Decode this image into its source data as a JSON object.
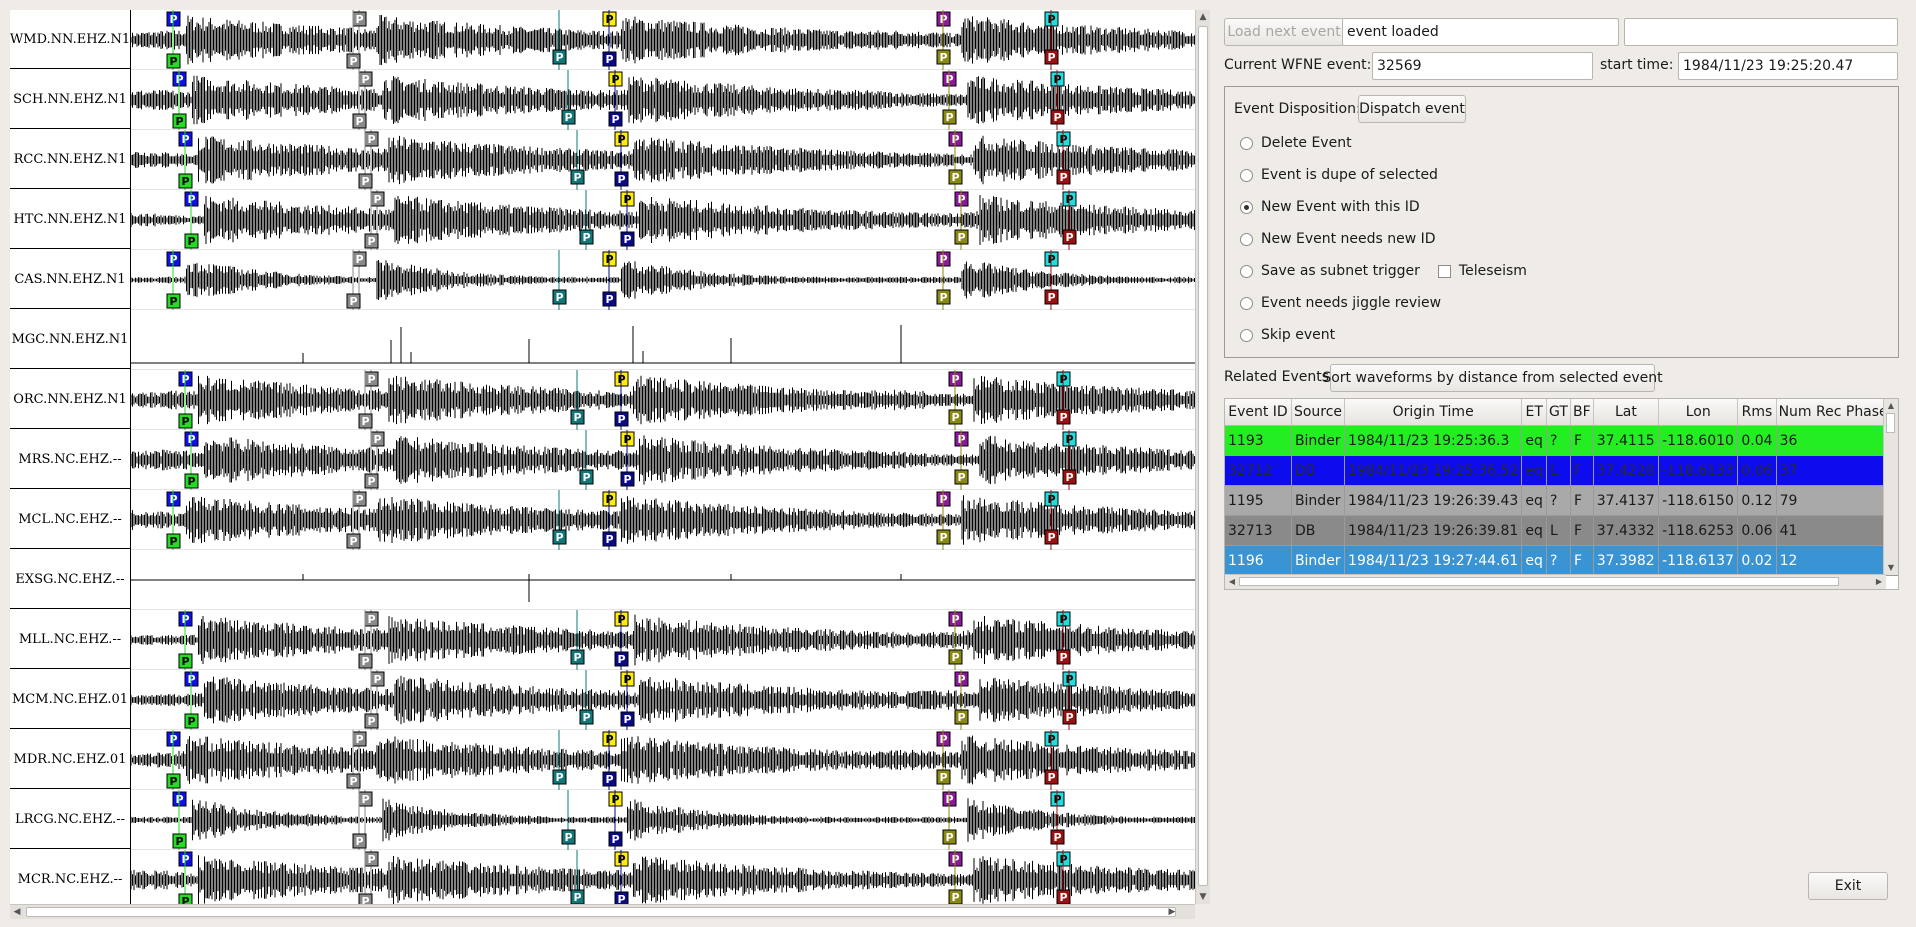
{
  "channels": [
    {
      "label": "WMD.NN.EHZ.N1",
      "type": "busy"
    },
    {
      "label": "SCH.NN.EHZ.N1",
      "type": "busy"
    },
    {
      "label": "RCC.NN.EHZ.N1",
      "type": "busy"
    },
    {
      "label": "HTC.NN.EHZ.N1",
      "type": "busy"
    },
    {
      "label": "CAS.NN.EHZ.N1",
      "type": "decay"
    },
    {
      "label": "MGC.NN.EHZ.N1",
      "type": "spikes"
    },
    {
      "label": "ORC.NN.EHZ.N1",
      "type": "busy"
    },
    {
      "label": "MRS.NC.EHZ.--",
      "type": "busy"
    },
    {
      "label": "MCL.NC.EHZ.--",
      "type": "busy"
    },
    {
      "label": "EXSG.NC.EHZ.--",
      "type": "flat"
    },
    {
      "label": "MLL.NC.EHZ.--",
      "type": "busy"
    },
    {
      "label": "MCM.NC.EHZ.01",
      "type": "busy"
    },
    {
      "label": "MDR.NC.EHZ.01",
      "type": "busy"
    },
    {
      "label": "LRCG.NC.EHZ.--",
      "type": "decay"
    },
    {
      "label": "MCR.NC.EHZ.--",
      "type": "busy"
    }
  ],
  "pick_label": "P",
  "pick_colors": {
    "green": "#22dd22",
    "blue": "#1010ee",
    "gray": "#8a8a8a",
    "teal": "#117777",
    "navy": "#0a0a88",
    "yellow": "#ffee00",
    "purple": "#8a1a9a",
    "olive": "#8a8a10",
    "cyan": "#22dddd",
    "darkred": "#991111"
  },
  "controls": {
    "load_next_label": "Load next event",
    "status_value": "event loaded",
    "extra_value": "",
    "current_event_label": "Current WFNE event:",
    "current_event_value": "32569",
    "start_time_label": "start time:",
    "start_time_value": "1984/11/23 19:25:20.47"
  },
  "disposition": {
    "label": "Event Disposition:",
    "dispatch_label": "Dispatch event",
    "options": [
      {
        "label": "Delete Event",
        "checked": false
      },
      {
        "label": "Event is dupe of selected",
        "checked": false
      },
      {
        "label": "New Event with this ID",
        "checked": true
      },
      {
        "label": "New Event needs new ID",
        "checked": false
      },
      {
        "label": "Save as subnet trigger",
        "checked": false
      },
      {
        "label": "Event needs jiggle review",
        "checked": false
      },
      {
        "label": "Skip event",
        "checked": false
      }
    ],
    "teleseism_label": "Teleseism"
  },
  "related": {
    "label": "Related Events:",
    "sort_label": "Sort waveforms by distance from selected event",
    "columns": [
      "Event ID",
      "Source",
      "Origin Time",
      "ET",
      "GT",
      "BF",
      "Lat",
      "Lon",
      "Rms",
      "Num Rec Phases"
    ],
    "rows": [
      {
        "cells": [
          "1193",
          "Binder",
          "1984/11/23 19:25:36.3",
          "eq",
          "?",
          "F",
          "37.4115",
          "-118.6010",
          "0.04",
          "36"
        ],
        "bg": "#22ee22",
        "selected": false
      },
      {
        "cells": [
          "32712",
          "DB",
          "1984/11/23 19:25:36.52",
          "eq",
          "L",
          "F",
          "37.4228",
          "-118.6133",
          "0.06",
          "37"
        ],
        "bg": "#0c0cee",
        "selected": false
      },
      {
        "cells": [
          "1195",
          "Binder",
          "1984/11/23 19:26:39.43",
          "eq",
          "?",
          "F",
          "37.4137",
          "-118.6150",
          "0.12",
          "79"
        ],
        "bg": "#a9a9a9",
        "selected": false
      },
      {
        "cells": [
          "32713",
          "DB",
          "1984/11/23 19:26:39.81",
          "eq",
          "L",
          "F",
          "37.4332",
          "-118.6253",
          "0.06",
          "41"
        ],
        "bg": "#8a8a8a",
        "selected": false
      },
      {
        "cells": [
          "1196",
          "Binder",
          "1984/11/23 19:27:44.61",
          "eq",
          "?",
          "F",
          "37.3982",
          "-118.6137",
          "0.02",
          "12"
        ],
        "bg": "#3a94d4",
        "selected": true
      }
    ]
  },
  "exit_label": "Exit"
}
